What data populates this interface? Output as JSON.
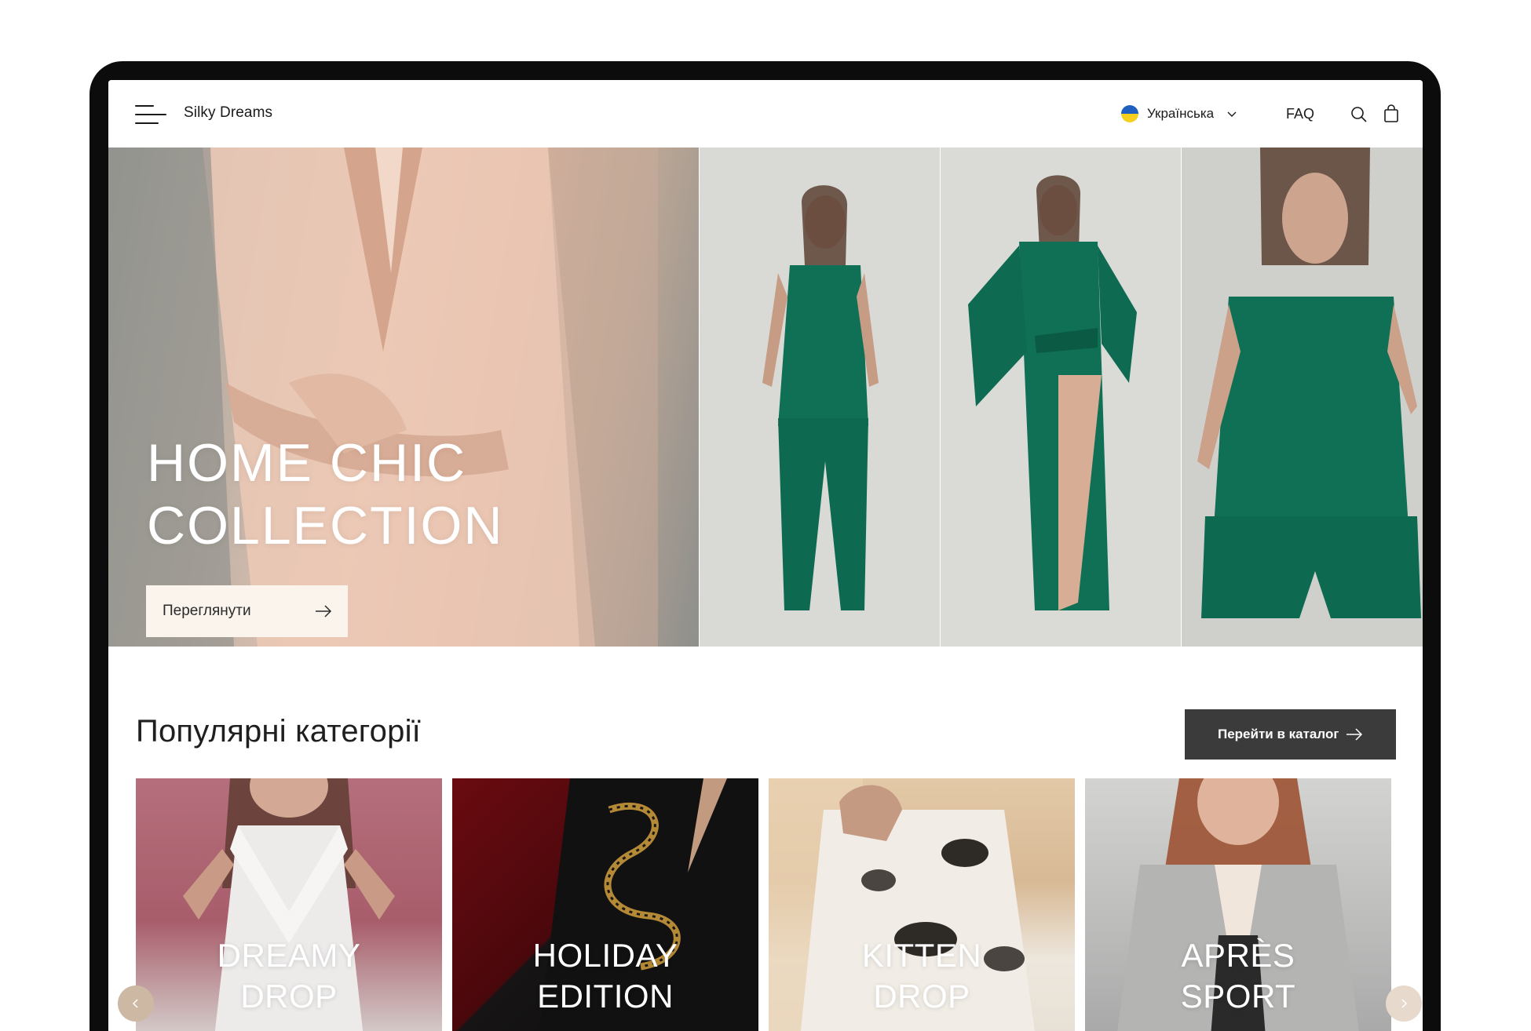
{
  "header": {
    "brand": "Silky Dreams",
    "language": "Українська",
    "faq": "FAQ"
  },
  "hero": {
    "title": "HOME CHIC\nCOLLECTION",
    "cta_label": "Переглянути"
  },
  "categories_section": {
    "title": "Популярні категорії",
    "catalog_button": "Перейти в каталог",
    "items": [
      {
        "title": "DREAMY\nDROP"
      },
      {
        "title": "HOLIDAY\nEDITION"
      },
      {
        "title": "KITTEN\nDROP"
      },
      {
        "title": "APRÈS\nSPORT"
      }
    ]
  },
  "colors": {
    "accent_dark": "#3b3b3b",
    "hero_button_bg": "#fbf4ec",
    "carousel_nav": "#cdb9a3",
    "satin_green": "#0f7056"
  },
  "icons": [
    "menu-icon",
    "ukraine-flag-icon",
    "chevron-down-icon",
    "search-icon",
    "shopping-bag-icon",
    "arrow-right-icon",
    "chevron-left-icon",
    "chevron-right-icon"
  ]
}
